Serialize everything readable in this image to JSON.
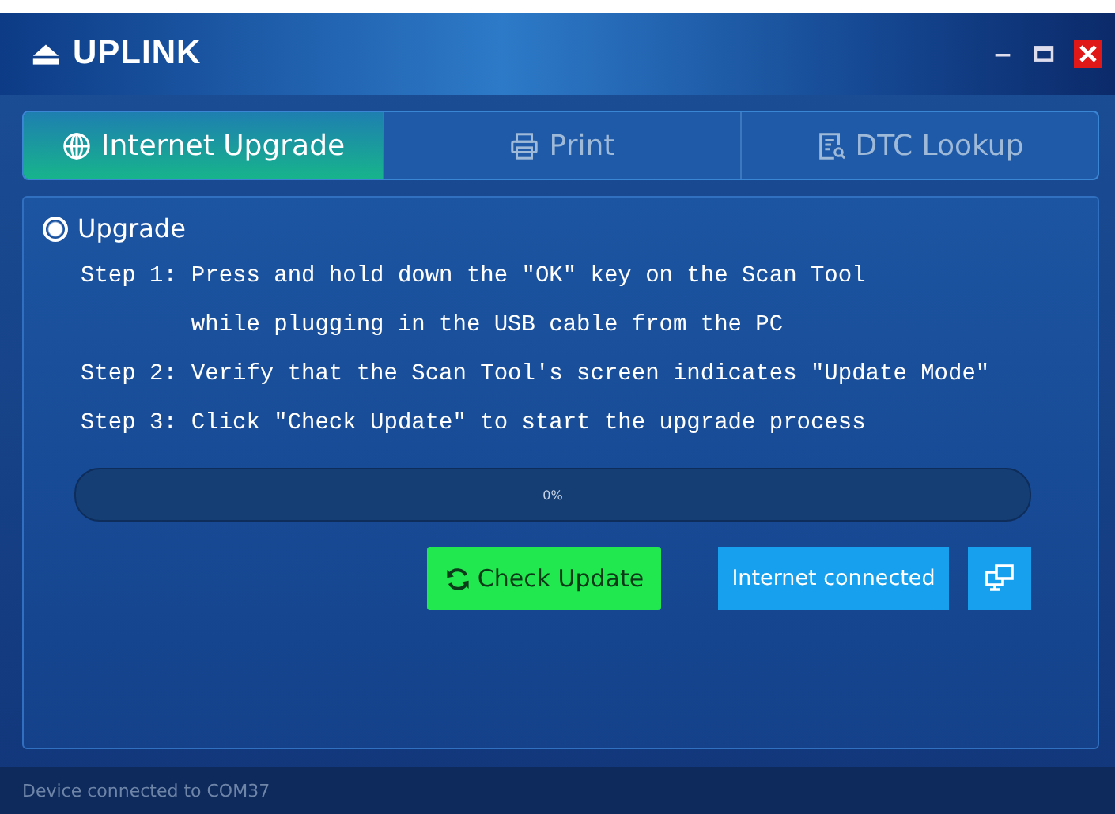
{
  "window": {
    "title": "UPLINK"
  },
  "tabs": [
    {
      "label": "Internet Upgrade",
      "selected": true
    },
    {
      "label": "Print",
      "selected": false
    },
    {
      "label": "DTC Lookup",
      "selected": false
    }
  ],
  "section": {
    "label": "Upgrade",
    "selected": true
  },
  "steps": [
    {
      "label": "Step 1:",
      "lines": [
        "Press and hold down the \"OK\" key on the Scan Tool",
        "while plugging in the USB cable from the PC"
      ]
    },
    {
      "label": "Step 2:",
      "lines": [
        "Verify that the Scan Tool's screen indicates \"Update Mode\""
      ]
    },
    {
      "label": "Step 3:",
      "lines": [
        "Click \"Check Update\" to start the upgrade process"
      ]
    }
  ],
  "progress": {
    "level": 0,
    "reading": "0%"
  },
  "check_button": {
    "label": "Check Update"
  },
  "status_button": {
    "label": "Internet connected"
  },
  "status_bar": {
    "text": "Device connected to COM37"
  }
}
